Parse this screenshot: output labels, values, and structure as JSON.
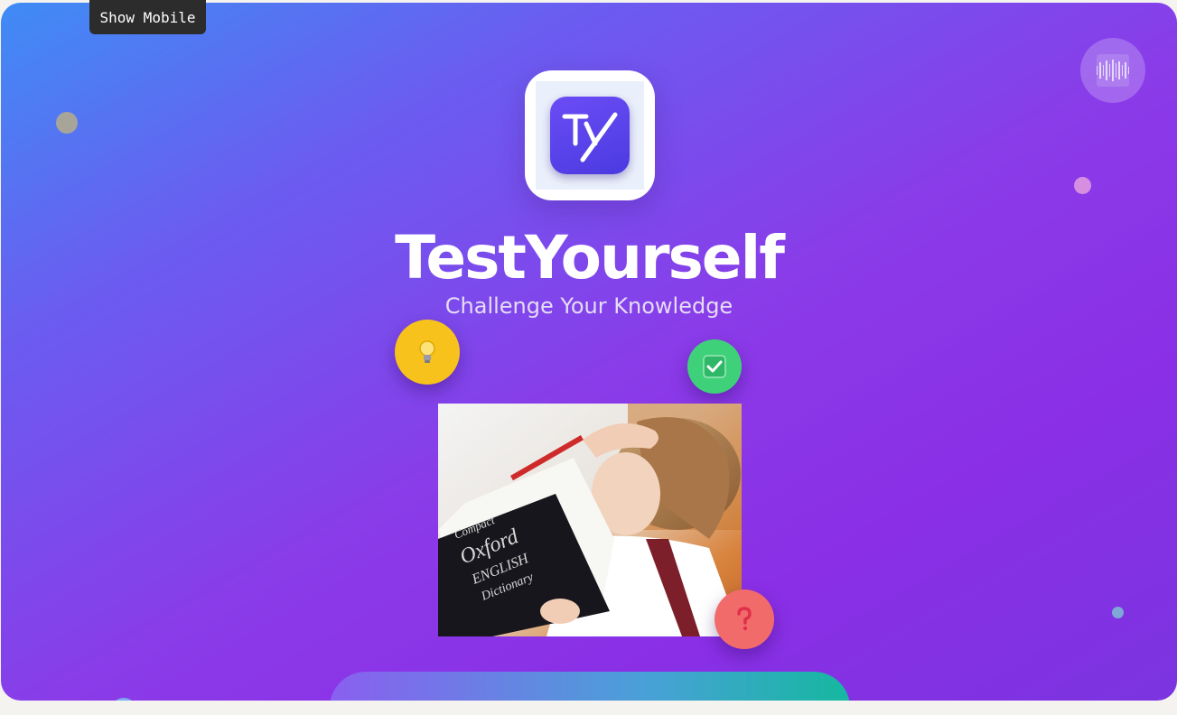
{
  "dev_toolbar": {
    "show_mobile_label": "Show Mobile"
  },
  "app": {
    "title": "TestYourself",
    "subtitle": "Challenge Your Knowledge",
    "logo_text": "Ty"
  },
  "icons": {
    "sound": "sound-wave-icon",
    "bulb": "lightbulb-icon",
    "check": "checkmark-icon",
    "question": "question-mark-icon"
  },
  "hero_image": {
    "book_title": "Compact Oxford ENGLISH Dictionary"
  },
  "colors": {
    "gradient_start": "#3f8cf5",
    "gradient_mid": "#8b3ae8",
    "bulb_badge": "#f8c21c",
    "check_badge": "#3fd17a",
    "question_badge": "#f26b6b"
  }
}
